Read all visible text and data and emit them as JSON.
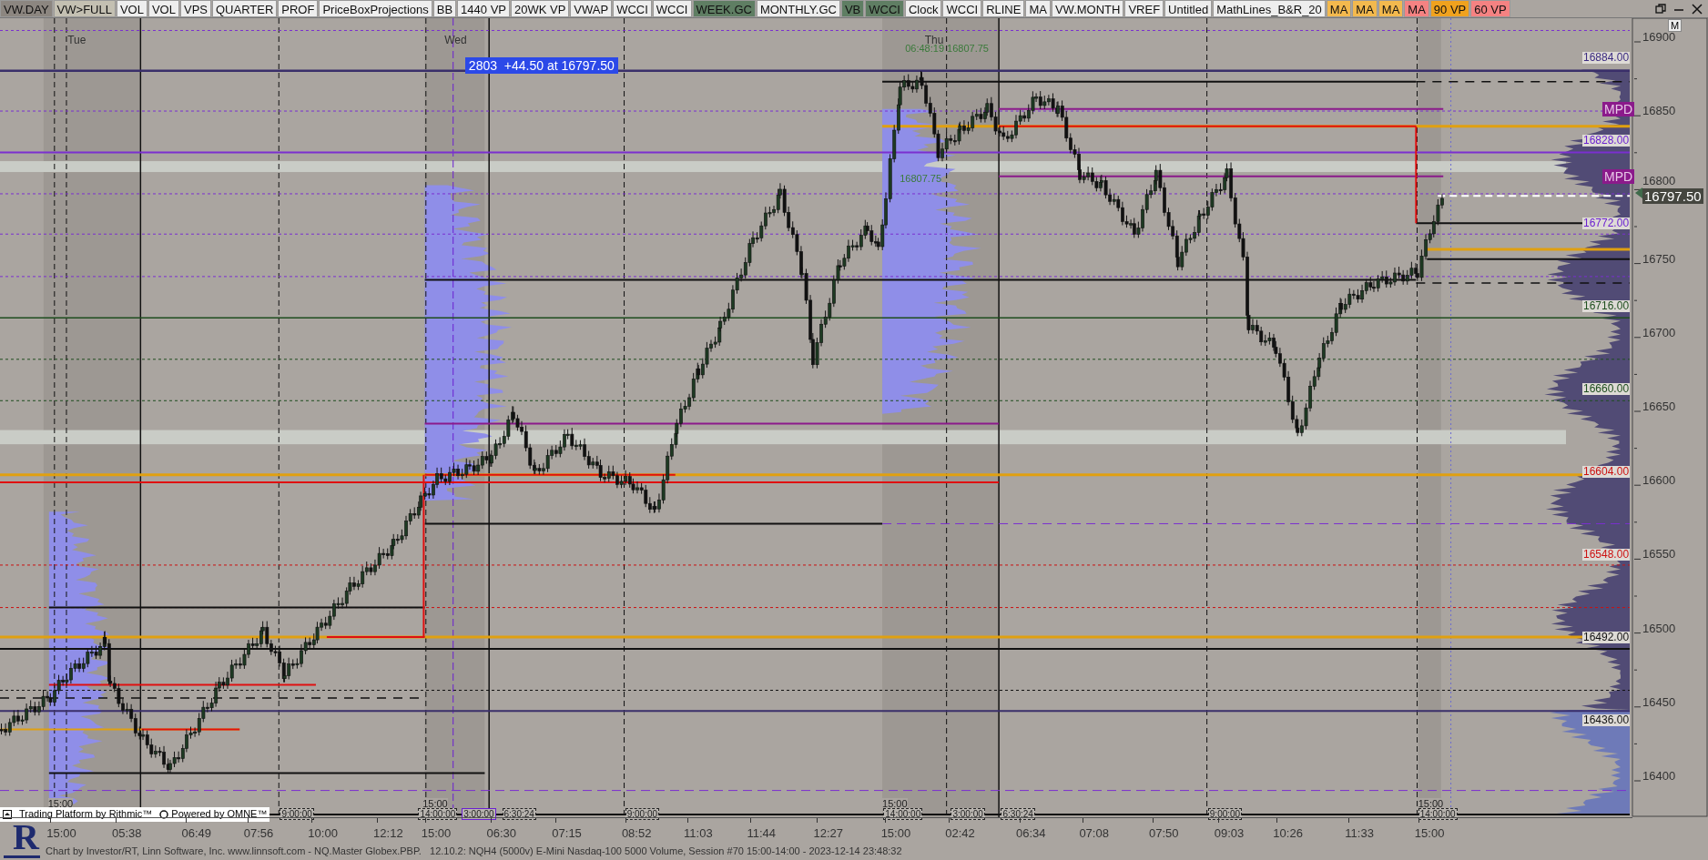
{
  "toolbar": {
    "buttons": [
      {
        "label": "VW.DAY",
        "color": "#8c8680"
      },
      {
        "label": "VW>FULL",
        "color": "#c4c0b2"
      },
      {
        "label": "VOL",
        "color": "#eeeeee"
      },
      {
        "label": "VOL",
        "color": "#eeeeee"
      },
      {
        "label": "VPS",
        "color": "#eeeeee"
      },
      {
        "label": "QUARTER",
        "color": "#eeeeee"
      },
      {
        "label": "PROF",
        "color": "#eeeeee"
      },
      {
        "label": "PriceBoxProjections",
        "color": "#eeeeee"
      },
      {
        "label": "BB",
        "color": "#eeeeee"
      },
      {
        "label": "1440 VP",
        "color": "#eeeeee"
      },
      {
        "label": "20WK VP",
        "color": "#eeeeee"
      },
      {
        "label": "VWAP",
        "color": "#eeeeee"
      },
      {
        "label": "WCCI",
        "color": "#eeeeee"
      },
      {
        "label": "WCCI",
        "color": "#eeeeee"
      },
      {
        "label": "WEEK.GC",
        "color": "#5f7e63"
      },
      {
        "label": "MONTHLY.GC",
        "color": "#eeeeee"
      },
      {
        "label": "VB",
        "color": "#5f7e63"
      },
      {
        "label": "WCCI",
        "color": "#5f7e63"
      },
      {
        "label": "Clock",
        "color": "#eeeeee"
      },
      {
        "label": "WCCI",
        "color": "#eeeeee"
      },
      {
        "label": "RLINE",
        "color": "#eeeeee"
      },
      {
        "label": "MA",
        "color": "#eeeeee"
      },
      {
        "label": "VW.MONTH",
        "color": "#eeeeee"
      },
      {
        "label": "VREF",
        "color": "#eeeeee"
      },
      {
        "label": "Untitled",
        "color": "#eeeeee"
      },
      {
        "label": "MathLines_B&R_20",
        "color": "#eeeeee"
      },
      {
        "label": "MA",
        "color": "#f3b94e"
      },
      {
        "label": "MA",
        "color": "#f3b94e"
      },
      {
        "label": "MA",
        "color": "#f3b94e"
      },
      {
        "label": "MA",
        "color": "#f58282"
      },
      {
        "label": "90 VP",
        "color": "#f0a21e"
      },
      {
        "label": "60 VP",
        "color": "#f58282"
      }
    ]
  },
  "chart": {
    "day_labels": [
      "Tue",
      "Wed",
      "Thu"
    ],
    "info_box": "2803  +44.50 at 16797.50",
    "high_note": "06:48:19 16807.75",
    "open_note": "16807.75",
    "mpd_labels": [
      "MPD",
      "MPD"
    ],
    "level_labels": [
      {
        "text": "16884.00",
        "color": "#3b2a80"
      },
      {
        "text": "16828.00",
        "color": "#6a1fd0"
      },
      {
        "text": "16772.00",
        "color": "#6a1fd0"
      },
      {
        "text": "16716.00",
        "color": "#1e4d1e"
      },
      {
        "text": "16660.00",
        "color": "#1e4d1e"
      },
      {
        "text": "16604.00",
        "color": "#cc1010"
      },
      {
        "text": "16548.00",
        "color": "#cc1010"
      },
      {
        "text": "16492.00",
        "color": "#111111"
      },
      {
        "text": "16436.00",
        "color": "#111111"
      }
    ],
    "session_marks": [
      "15:00",
      "9:00:00",
      "15:00",
      "14:00:00",
      "3:00:00",
      "6:30:24",
      "9:00:00",
      "15:00",
      "14:00:00",
      "3:00:00",
      "6:30:24",
      "9:00:00",
      "15:00",
      "14:00:00"
    ],
    "branding": [
      "Trading Platform by Rithmic™",
      "Powered by OMNE™"
    ],
    "price_axis": {
      "ticks": [
        "16900",
        "16850",
        "16800",
        "16750",
        "16700",
        "16650",
        "16600",
        "16550",
        "16500",
        "16450",
        "16400"
      ],
      "last_price": "16797.50",
      "marker": "M"
    },
    "time_axis": [
      "15:00",
      "05:38",
      "06:49",
      "07:56",
      "10:00",
      "12:12",
      "15:00",
      "06:30",
      "07:15",
      "08:52",
      "11:03",
      "11:44",
      "12:27",
      "15:00",
      "02:42",
      "06:34",
      "07:08",
      "07:50",
      "09:03",
      "10:26",
      "11:33",
      "15:00"
    ]
  },
  "logo": {
    "letter": "R"
  },
  "status_bar": "Chart by Investor/RT, Linn Software, Inc. www.linnsoft.com - NQ.Master Globex.PBP.   12.10.2: NQH4 (5000v) E-Mini Nasdaq-100 5000 Volume, Session #70 15:00-14:00 - 2023-12-14 23:48:32"
}
